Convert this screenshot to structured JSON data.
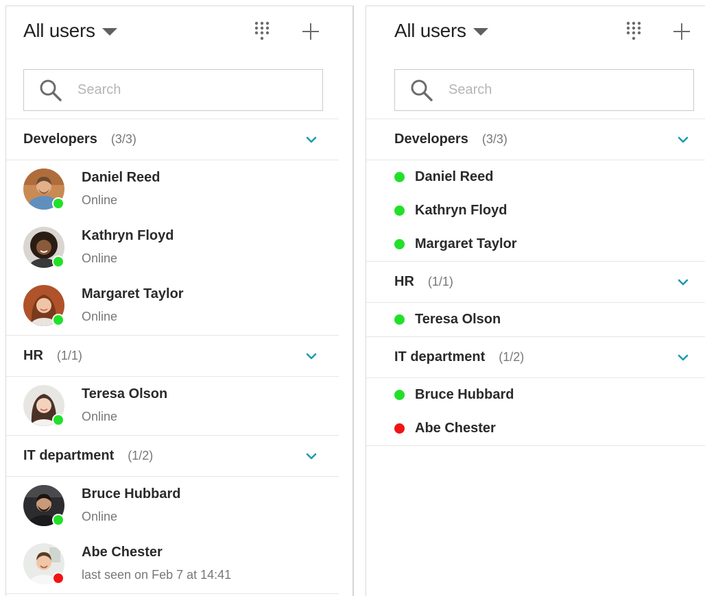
{
  "colors": {
    "online": "#22e02a",
    "offline": "#f01414",
    "accent": "#1a9bb0"
  },
  "left": {
    "title": "All users",
    "search_placeholder": "Search",
    "groups": [
      {
        "name": "Developers",
        "count": "(3/3)",
        "users": [
          {
            "name": "Daniel Reed",
            "status_text": "Online",
            "status": "online"
          },
          {
            "name": "Kathryn Floyd",
            "status_text": "Online",
            "status": "online"
          },
          {
            "name": "Margaret Taylor",
            "status_text": "Online",
            "status": "online"
          }
        ]
      },
      {
        "name": "HR",
        "count": "(1/1)",
        "users": [
          {
            "name": "Teresa Olson",
            "status_text": "Online",
            "status": "online"
          }
        ]
      },
      {
        "name": "IT department",
        "count": "(1/2)",
        "users": [
          {
            "name": "Bruce Hubbard",
            "status_text": "Online",
            "status": "online"
          },
          {
            "name": "Abe Chester",
            "status_text": "last seen on Feb 7 at 14:41",
            "status": "offline"
          }
        ]
      }
    ]
  },
  "right": {
    "title": "All users",
    "search_placeholder": "Search",
    "groups": [
      {
        "name": "Developers",
        "count": "(3/3)",
        "users": [
          {
            "name": "Daniel Reed",
            "status": "online"
          },
          {
            "name": "Kathryn Floyd",
            "status": "online"
          },
          {
            "name": "Margaret Taylor",
            "status": "online"
          }
        ]
      },
      {
        "name": "HR",
        "count": "(1/1)",
        "users": [
          {
            "name": "Teresa Olson",
            "status": "online"
          }
        ]
      },
      {
        "name": "IT department",
        "count": "(1/2)",
        "users": [
          {
            "name": "Bruce Hubbard",
            "status": "online"
          },
          {
            "name": "Abe Chester",
            "status": "offline"
          }
        ]
      }
    ]
  }
}
